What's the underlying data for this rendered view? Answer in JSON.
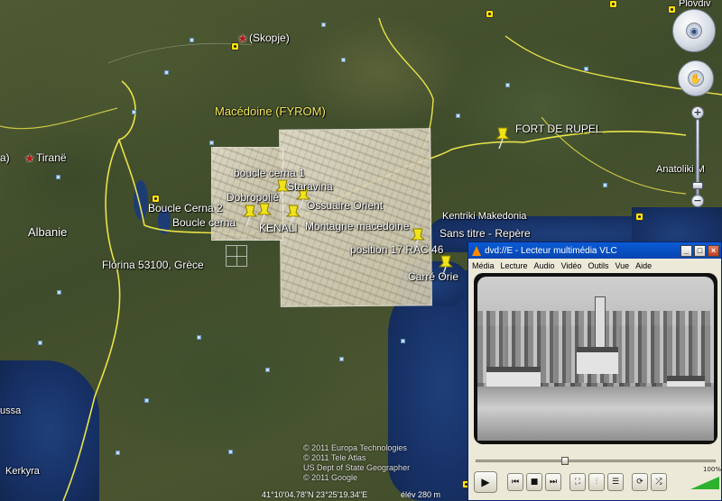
{
  "map": {
    "labels": {
      "skopje": "(Skopje)",
      "tirane": "Tiranë",
      "tirane_prefix": "a)",
      "macedoine": "Macédoine (FYROM)",
      "albanie": "Albanie",
      "kentriki": "Kentriki Makedonia",
      "anatoliki": "Anatoliki M",
      "florina": "Flórina 53100, Grèce",
      "kerkyra": "Kerkyra",
      "ussa": "ussa",
      "ploudiv": "Plovdiv"
    },
    "placemarks": {
      "fort_de_rupel": "FORT DE RUPEL",
      "boucle_cerna_1": "boucle cerna 1",
      "staravina": "Staravina",
      "dobropolie": "Dobropolié",
      "ossuaire_orient": "Ossuaire Orient",
      "boucle_cerna_2": "Boucle Cerna 2",
      "boucle_cerna": "Boucle cerna",
      "kenali": "KENALI",
      "montagne_macedoine": "Montagne macedoine",
      "sans_titre": "Sans titre - Repère",
      "position_17": "position 17 RAC 46",
      "carre_orient": "Carré Orie"
    },
    "copyright": {
      "line1": "© 2011 Europa Technologies",
      "line2": "© 2011 Tele Atlas",
      "line3": "US Dept of State Geographer",
      "line4": "© 2011 Google"
    },
    "status": {
      "coords": "41°10'04.78\"N    23°25'19.34\"E",
      "elevation": "élév  280 m"
    },
    "nav": {
      "zoom_in": "+",
      "zoom_out": "−"
    }
  },
  "vlc": {
    "title": "dvd://E - Lecteur multimédia VLC",
    "window_buttons": {
      "minimize": "_",
      "maximize": "□",
      "close": "×"
    },
    "menu": [
      "Média",
      "Lecture",
      "Audio",
      "Vidéo",
      "Outils",
      "Vue",
      "Aide"
    ],
    "seek_fraction": 0.37,
    "volume_percent": "100%",
    "buttons": {
      "play": "▶",
      "prev": "⏮",
      "stop": "■",
      "next": "⏭",
      "fullscreen": "⛶",
      "playlist": "☰",
      "extended": "⫶",
      "loop": "⟳",
      "random": "⤮"
    }
  }
}
